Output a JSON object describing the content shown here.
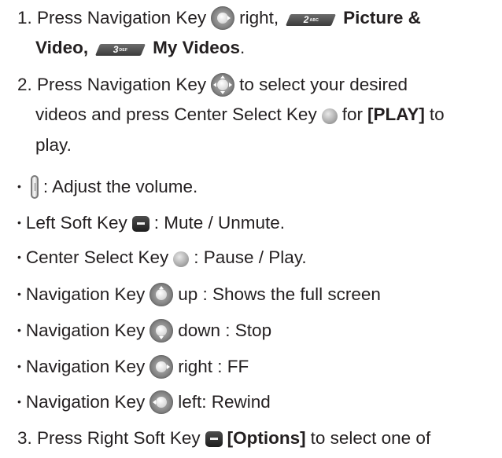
{
  "step1": {
    "prefix": "1. Press Navigation Key",
    "dir": "right,",
    "key2_num": "2",
    "key2_letters": "ABC",
    "picture": "Picture &",
    "video": "Video,",
    "key3_num": "3",
    "key3_letters": "DEF",
    "myvideos": "My Videos",
    "period": "."
  },
  "step2": {
    "prefix": "2. Press Navigation Key",
    "mid": "to select your desired",
    "line2a": "videos and press Center Select Key",
    "line2b": "for",
    "play": "[PLAY]",
    "line2c": "to",
    "line3": "play."
  },
  "bullets": [
    {
      "text": ": Adjust the volume.",
      "pre": "",
      "key": "volume"
    },
    {
      "pre": "Left Soft Key",
      "key": "left-soft",
      "text": ": Mute / Unmute."
    },
    {
      "pre": "Center Select Key",
      "key": "center",
      "text": ": Pause / Play."
    },
    {
      "pre": "Navigation Key",
      "key": "nav-up",
      "text": "up : Shows the full screen"
    },
    {
      "pre": "Navigation Key",
      "key": "nav-down",
      "text": "down : Stop"
    },
    {
      "pre": "Navigation Key",
      "key": "nav-right",
      "text": "right : FF"
    },
    {
      "pre": "Navigation Key",
      "key": "nav-left",
      "text": "left: Rewind"
    }
  ],
  "step3": {
    "prefix": "3. Press Right Soft Key",
    "options": "[Options]",
    "rest": "to select one of"
  },
  "bullet_char": "•",
  "icons": [
    "navigation-key-icon",
    "number-key-2-icon",
    "number-key-3-icon",
    "center-select-key-icon",
    "volume-key-icon",
    "left-soft-key-icon",
    "right-soft-key-icon"
  ]
}
